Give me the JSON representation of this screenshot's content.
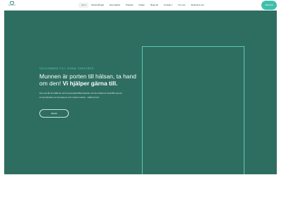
{
  "brand": {
    "logo_text": "TANDVÅRD",
    "accent": "#3fbfab",
    "hero_bg": "#2e6e60"
  },
  "nav": {
    "items": [
      {
        "label": "Hem",
        "active": true,
        "has_dropdown": false
      },
      {
        "label": "Behandlingar",
        "active": false,
        "has_dropdown": false
      },
      {
        "label": "Ett praktisk",
        "active": false,
        "has_dropdown": false
      },
      {
        "label": "Prislista",
        "active": false,
        "has_dropdown": false
      },
      {
        "label": "Frågor",
        "active": false,
        "has_dropdown": false
      },
      {
        "label": "Boka tid",
        "active": false,
        "has_dropdown": false
      },
      {
        "label": "Kontakt",
        "active": false,
        "has_dropdown": true
      },
      {
        "label": "Om oss",
        "active": false,
        "has_dropdown": false
      },
      {
        "label": "Rekrytera oss",
        "active": false,
        "has_dropdown": false
      }
    ],
    "cta_label": "Boka tid"
  },
  "hero": {
    "eyebrow": "Välkommen till Sinna Tandvård",
    "headline_regular": "Munnen är porten till hälsan, ta hand om den!",
    "headline_bold": "Vi hjälper gärna till.",
    "intro": "Hos oss får du träffa ett varmt personligt tillbemötande och den bästa av tandvård genom en kombination av kompetens och modern teknik – Välkommen!",
    "button_label": "Besök"
  }
}
